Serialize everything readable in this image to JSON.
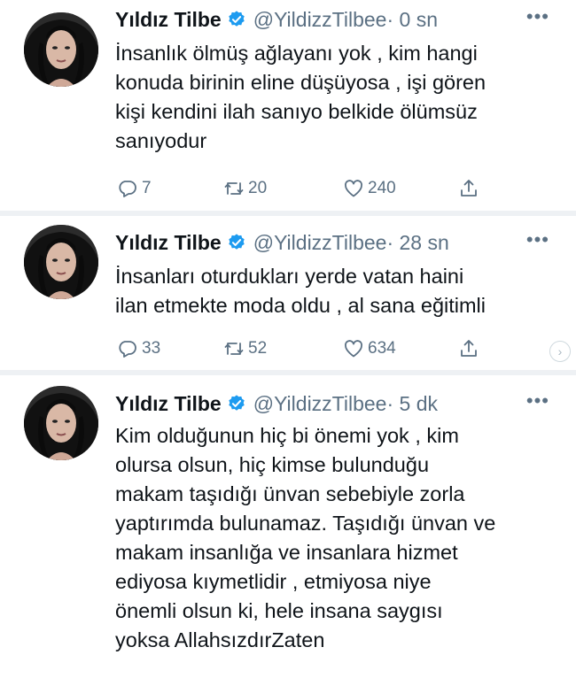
{
  "tweets": [
    {
      "name": "Yıldız Tilbe",
      "handle": "@YildizzTilbee",
      "time": "· 0 sn",
      "text": "İnsanlık ölmüş ağlayanı yok , kim hangi\nkonuda birinin eline düşüyosa , işi gören\nkişi kendini ilah sanıyo belkide ölümsüz\nsanıyodur",
      "replies": "7",
      "retweets": "20",
      "likes": "240"
    },
    {
      "name": "Yıldız Tilbe",
      "handle": "@YildizzTilbee",
      "time": "· 28 sn",
      "text": "İnsanları oturdukları yerde vatan haini\nilan etmekte moda oldu , al sana eğitimli",
      "replies": "33",
      "retweets": "52",
      "likes": "634"
    },
    {
      "name": "Yıldız Tilbe",
      "handle": "@YildizzTilbee",
      "time": "· 5 dk",
      "text": "Kim olduğunun hiç bi önemi yok , kim\nolursa olsun, hiç kimse bulunduğu\nmakam taşıdığı ünvan sebebiyle zorla\nyaptırımda bulunamaz. Taşıdığı ünvan ve\nmakam insanlığa ve insanlara hizmet\nediyosa kıymetlidir , etmiyosa niye\nönemli olsun ki, hele insana saygısı\nyoksa AllahsızdırZaten"
    }
  ],
  "icons": {
    "more": "more-icon",
    "verified": "verified-badge-icon",
    "reply": "reply-icon",
    "retweet": "retweet-icon",
    "like": "heart-icon",
    "share": "share-icon"
  },
  "colors": {
    "verified": "#1d9bf0",
    "muted": "#5b7083",
    "separator": "#eef1f4"
  }
}
